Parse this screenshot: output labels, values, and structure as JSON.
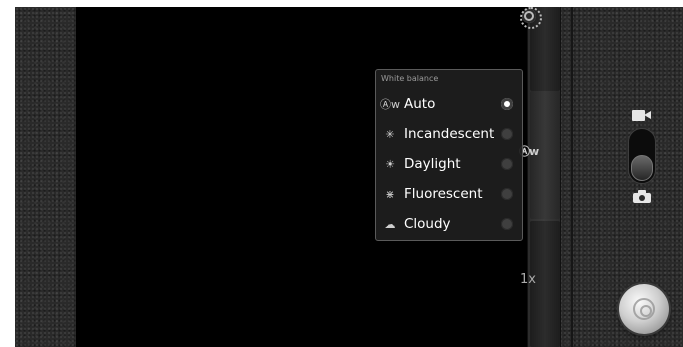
{
  "strip": {
    "zoom_label": "1x",
    "current_wb_icon": "Ⓐᴡ"
  },
  "wb_popup": {
    "title": "White balance",
    "options": [
      {
        "label": "Auto",
        "icon": "Ⓐᴡ",
        "icon_name": "wb-auto-icon",
        "selected": true
      },
      {
        "label": "Incandescent",
        "icon": "✳",
        "icon_name": "wb-incandescent-icon",
        "selected": false
      },
      {
        "label": "Daylight",
        "icon": "☀",
        "icon_name": "wb-daylight-icon",
        "selected": false
      },
      {
        "label": "Fluorescent",
        "icon": "⋇",
        "icon_name": "wb-fluorescent-icon",
        "selected": false
      },
      {
        "label": "Cloudy",
        "icon": "☁",
        "icon_name": "wb-cloudy-icon",
        "selected": false
      }
    ]
  },
  "controls": {
    "mode": "camera"
  }
}
